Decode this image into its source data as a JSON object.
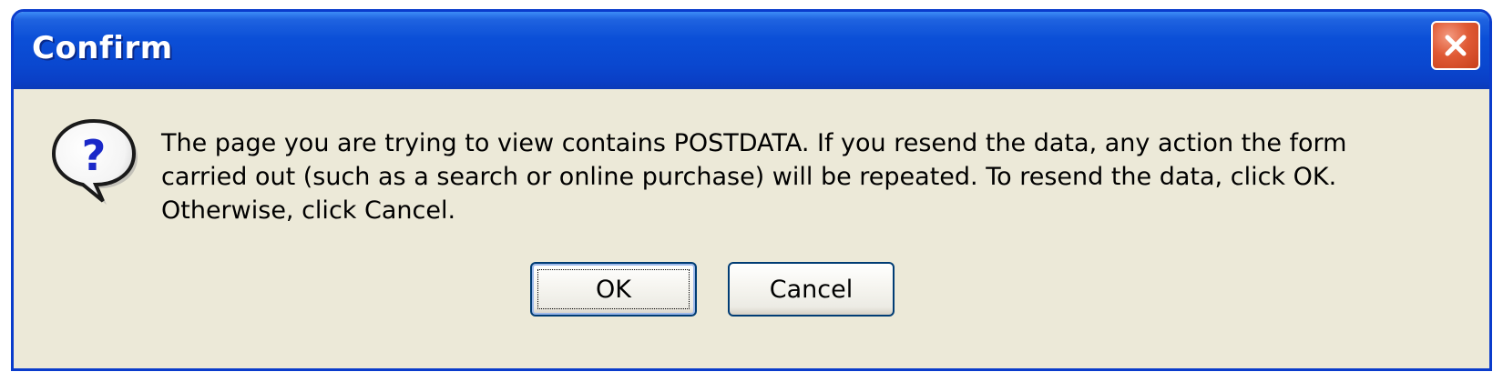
{
  "window": {
    "title": "Confirm",
    "accent_color": "#0a47cf",
    "close_icon": "close-icon",
    "close_color": "#e05a35"
  },
  "dialog": {
    "icon": "question-icon",
    "message_lines": [
      "The page you are trying to view contains POSTDATA. If you resend the data, any action the form",
      "carried out (such as a search or online purchase) will be repeated. To resend the data, click OK.",
      "Otherwise, click Cancel."
    ]
  },
  "buttons": {
    "ok_label": "OK",
    "cancel_label": "Cancel"
  }
}
